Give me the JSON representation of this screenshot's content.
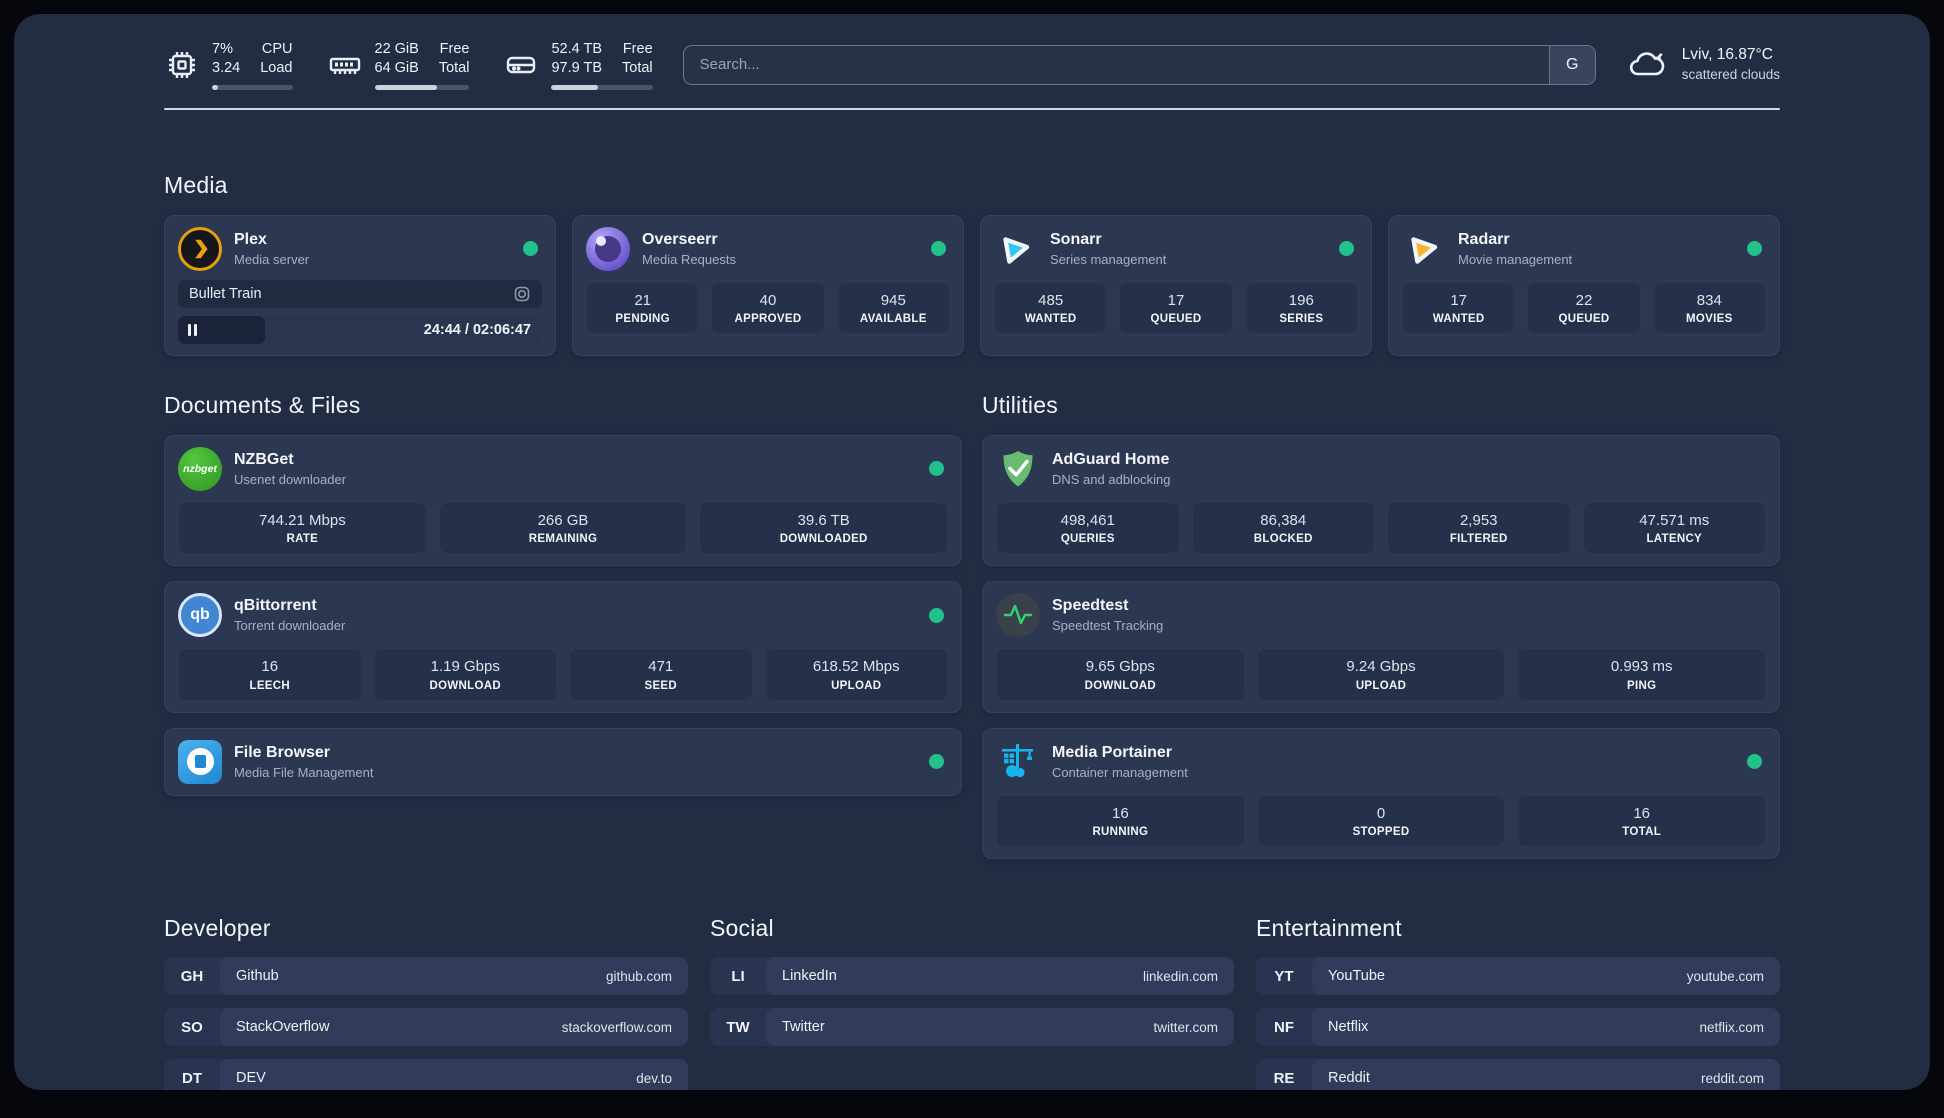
{
  "colors": {
    "status_online": "#22c08b",
    "plex": "#e5a00d",
    "overseerr": "#6a55cf",
    "sonarr": "#35c5f4",
    "radarr": "#f5b52e",
    "nzbget": "#2f9423",
    "qbittorrent": "#4285d4",
    "adguard": "#68bc71",
    "speedtest": "#2dd673",
    "filebrowser": "#1e88d2",
    "portainer": "#13b5ea"
  },
  "header": {
    "stats": [
      {
        "icon": "cpu-chip-icon",
        "value_top": "7%",
        "value_bottom": "3.24",
        "label_top": "CPU",
        "label_bottom": "Load",
        "progress_percent": 7
      },
      {
        "icon": "memory-icon",
        "value_top": "22 GiB",
        "value_bottom": "64 GiB",
        "label_top": "Free",
        "label_bottom": "Total",
        "progress_percent": 66
      },
      {
        "icon": "hard-drive-icon",
        "value_top": "52.4 TB",
        "value_bottom": "97.9 TB",
        "label_top": "Free",
        "label_bottom": "Total",
        "progress_percent": 46
      }
    ],
    "search": {
      "placeholder": "Search...",
      "engine_button": "G"
    },
    "weather": {
      "location": "Lviv, 16.87°C",
      "condition": "scattered clouds"
    }
  },
  "media": {
    "title": "Media",
    "apps": [
      {
        "name": "Plex",
        "description": "Media server",
        "online": true,
        "player": {
          "now_playing": "Bullet Train",
          "time": "24:44 / 02:06:47",
          "progress_percent": 24
        }
      },
      {
        "name": "Overseerr",
        "description": "Media Requests",
        "online": true,
        "stats": [
          {
            "value": "21",
            "label": "PENDING"
          },
          {
            "value": "40",
            "label": "APPROVED"
          },
          {
            "value": "945",
            "label": "AVAILABLE"
          }
        ]
      },
      {
        "name": "Sonarr",
        "description": "Series management",
        "online": true,
        "stats": [
          {
            "value": "485",
            "label": "WANTED"
          },
          {
            "value": "17",
            "label": "QUEUED"
          },
          {
            "value": "196",
            "label": "SERIES"
          }
        ]
      },
      {
        "name": "Radarr",
        "description": "Movie management",
        "online": true,
        "stats": [
          {
            "value": "17",
            "label": "WANTED"
          },
          {
            "value": "22",
            "label": "QUEUED"
          },
          {
            "value": "834",
            "label": "MOVIES"
          }
        ]
      }
    ]
  },
  "documents": {
    "title": "Documents & Files",
    "apps": [
      {
        "name": "NZBGet",
        "description": "Usenet downloader",
        "online": true,
        "stats": [
          {
            "value": "744.21 Mbps",
            "label": "RATE"
          },
          {
            "value": "266 GB",
            "label": "REMAINING"
          },
          {
            "value": "39.6 TB",
            "label": "DOWNLOADED"
          }
        ]
      },
      {
        "name": "qBittorrent",
        "description": "Torrent downloader",
        "online": true,
        "stats": [
          {
            "value": "16",
            "label": "LEECH"
          },
          {
            "value": "1.19 Gbps",
            "label": "DOWNLOAD"
          },
          {
            "value": "471",
            "label": "SEED"
          },
          {
            "value": "618.52 Mbps",
            "label": "UPLOAD"
          }
        ]
      },
      {
        "name": "File Browser",
        "description": "Media File Management",
        "online": true
      }
    ]
  },
  "utilities": {
    "title": "Utilities",
    "apps": [
      {
        "name": "AdGuard Home",
        "description": "DNS and adblocking",
        "online": false,
        "stats": [
          {
            "value": "498,461",
            "label": "QUERIES"
          },
          {
            "value": "86,384",
            "label": "BLOCKED"
          },
          {
            "value": "2,953",
            "label": "FILTERED"
          },
          {
            "value": "47.571 ms",
            "label": "LATENCY"
          }
        ]
      },
      {
        "name": "Speedtest",
        "description": "Speedtest Tracking",
        "online": false,
        "stats": [
          {
            "value": "9.65 Gbps",
            "label": "DOWNLOAD"
          },
          {
            "value": "9.24 Gbps",
            "label": "UPLOAD"
          },
          {
            "value": "0.993 ms",
            "label": "PING"
          }
        ]
      },
      {
        "name": "Media Portainer",
        "description": "Container management",
        "online": true,
        "stats": [
          {
            "value": "16",
            "label": "RUNNING"
          },
          {
            "value": "0",
            "label": "STOPPED"
          },
          {
            "value": "16",
            "label": "TOTAL"
          }
        ]
      }
    ]
  },
  "bookmarks": [
    {
      "title": "Developer",
      "links": [
        {
          "abbr": "GH",
          "name": "Github",
          "url": "github.com"
        },
        {
          "abbr": "SO",
          "name": "StackOverflow",
          "url": "stackoverflow.com"
        },
        {
          "abbr": "DT",
          "name": "DEV",
          "url": "dev.to"
        }
      ]
    },
    {
      "title": "Social",
      "links": [
        {
          "abbr": "LI",
          "name": "LinkedIn",
          "url": "linkedin.com"
        },
        {
          "abbr": "TW",
          "name": "Twitter",
          "url": "twitter.com"
        }
      ]
    },
    {
      "title": "Entertainment",
      "links": [
        {
          "abbr": "YT",
          "name": "YouTube",
          "url": "youtube.com"
        },
        {
          "abbr": "NF",
          "name": "Netflix",
          "url": "netflix.com"
        },
        {
          "abbr": "RE",
          "name": "Reddit",
          "url": "reddit.com"
        }
      ]
    }
  ]
}
